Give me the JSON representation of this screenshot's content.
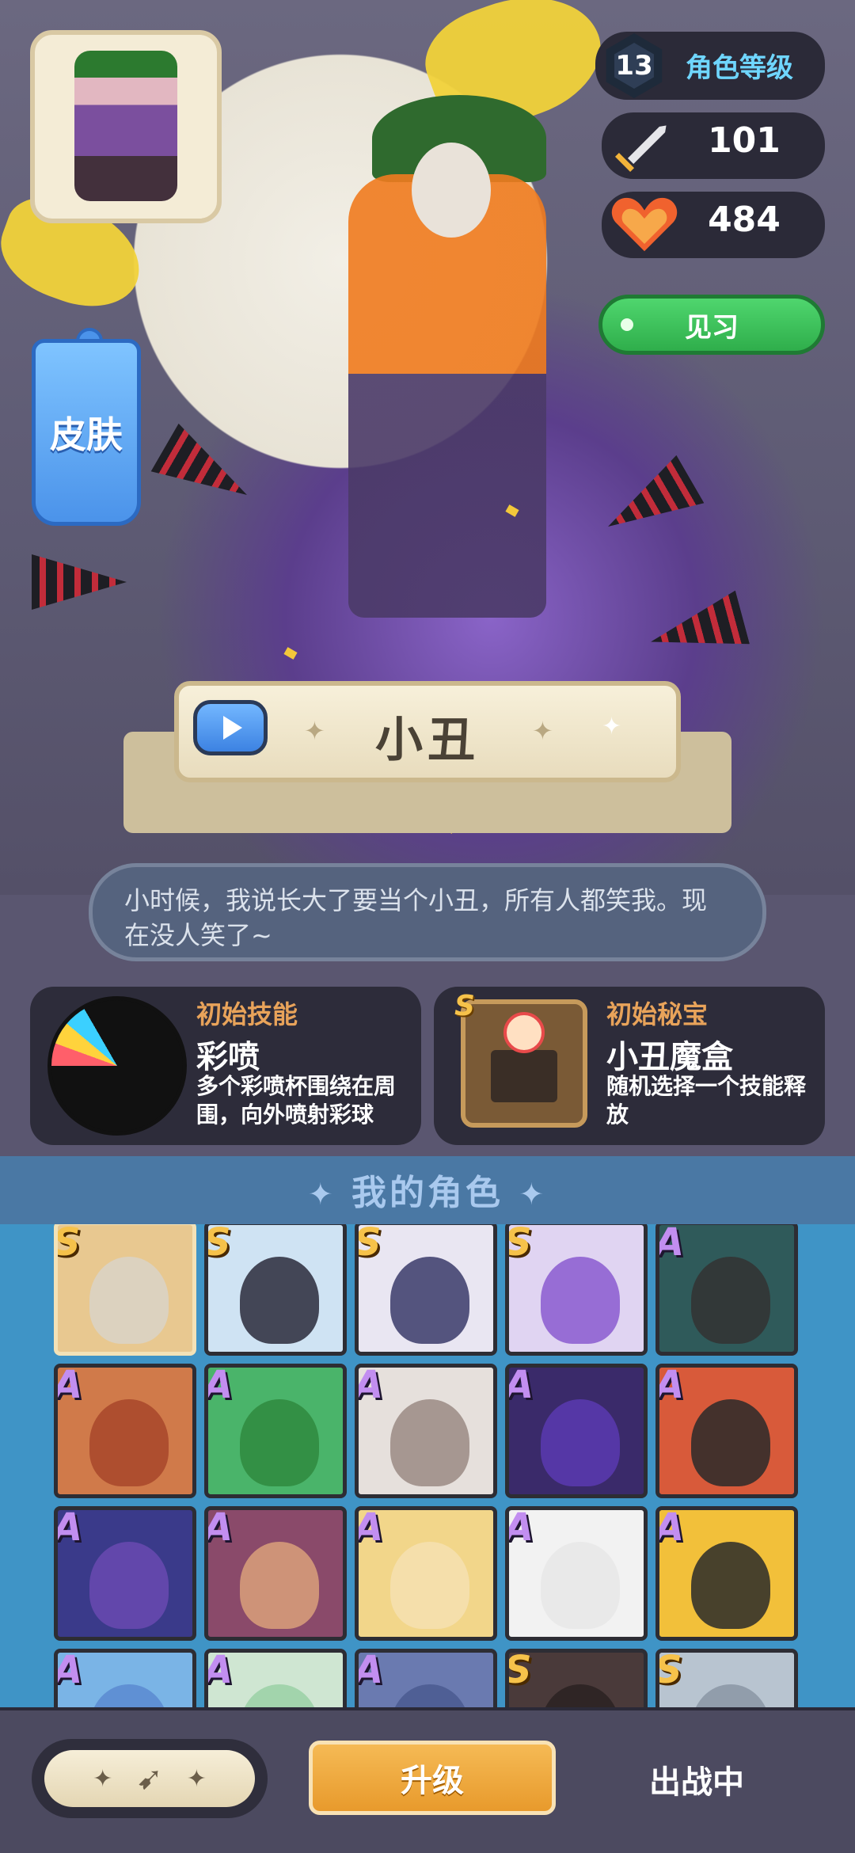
{
  "character": {
    "name": "小丑",
    "level": "13",
    "level_label": "角色等级",
    "attack": "101",
    "hp": "484",
    "status_tag": "见习",
    "skin_label": "皮肤",
    "quote": "小时候，我说长大了要当个小丑，所有人都笑我。现在没人笑了~"
  },
  "skill": {
    "kicker": "初始技能",
    "name": "彩喷",
    "desc": "多个彩喷杯围绕在周围，向外喷射彩球"
  },
  "treasure": {
    "grade": "S",
    "kicker": "初始秘宝",
    "name": "小丑魔盒",
    "desc": "随机选择一个技能释放"
  },
  "roster": {
    "title": "我的角色",
    "tiles": [
      {
        "grade": "S",
        "bg": "#e8c890",
        "face": "#d9d4c8"
      },
      {
        "grade": "S",
        "bg": "#cfe3f3",
        "face": "#2a2a3a"
      },
      {
        "grade": "S",
        "bg": "#e9e6f2",
        "face": "#3a3a6a"
      },
      {
        "grade": "S",
        "bg": "#e0d4f2",
        "face": "#8a5ad0"
      },
      {
        "grade": "A",
        "bg": "#2f5a5a",
        "face": "#333"
      },
      {
        "grade": "A",
        "bg": "#d07a4a",
        "face": "#a8462a"
      },
      {
        "grade": "A",
        "bg": "#4ab46a",
        "face": "#2f8a3e"
      },
      {
        "grade": "A",
        "bg": "#e6e0dc",
        "face": "#9a8a84"
      },
      {
        "grade": "A",
        "bg": "#3a2a6a",
        "face": "#5a3ab0"
      },
      {
        "grade": "A",
        "bg": "#d85a3a",
        "face": "#2a2a2a"
      },
      {
        "grade": "A",
        "bg": "#3a3a8a",
        "face": "#6a4ab0"
      },
      {
        "grade": "A",
        "bg": "#8a4a6a",
        "face": "#d9a07a"
      },
      {
        "grade": "A",
        "bg": "#f2d68a",
        "face": "#f6e0b0"
      },
      {
        "grade": "A",
        "bg": "#f2f2f2",
        "face": "#e8e8e8"
      },
      {
        "grade": "A",
        "bg": "#f2c03a",
        "face": "#2a2a2a"
      },
      {
        "grade": "A",
        "bg": "#7ab4e6",
        "face": "#5a8ad0"
      },
      {
        "grade": "A",
        "bg": "#cfe6d2",
        "face": "#9ad0a6"
      },
      {
        "grade": "A",
        "bg": "#6a7ab0",
        "face": "#4a5a90"
      },
      {
        "grade": "S",
        "bg": "#4a3a3a",
        "face": "#2a2222"
      },
      {
        "grade": "S",
        "bg": "#b8c4d0",
        "face": "#8a96a4"
      }
    ]
  },
  "actions": {
    "upgrade": "升级",
    "status": "出战中"
  },
  "colors": {
    "accent_green": "#2fae4b",
    "accent_orange": "#e89a2c",
    "grade_a": "#c28ef0",
    "grade_s": "#f6c24a"
  }
}
